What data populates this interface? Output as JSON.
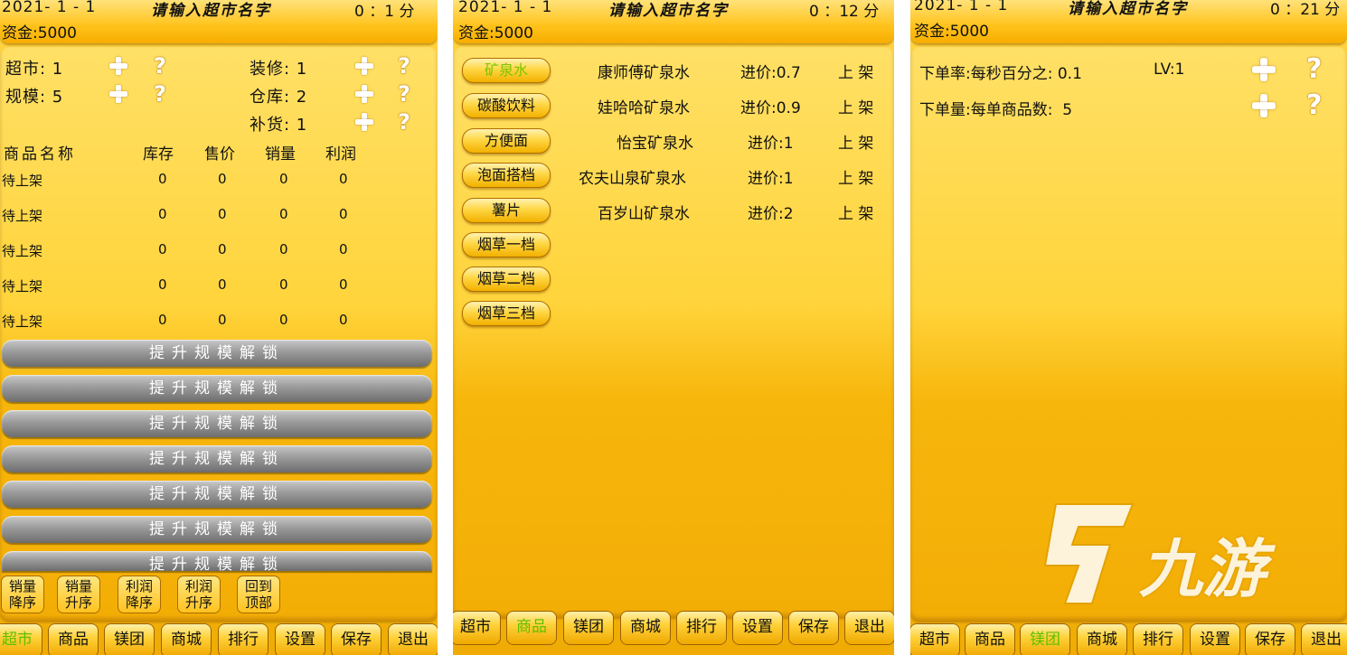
{
  "header": {
    "date": "2021- 1 - 1",
    "store_name": "请输入超市名字",
    "money": "资金:5000"
  },
  "panels": [
    {
      "time": "0 ：1 分"
    },
    {
      "time": "0 ：12 分"
    },
    {
      "time": "0 ：21 分"
    }
  ],
  "p1": {
    "upgrades": {
      "supermarket": "超市: 1",
      "scale": "规模: 5",
      "decoration": "装修: 1",
      "warehouse": "仓库: 2",
      "restock": "补货: 1"
    },
    "table": {
      "headers": [
        "商品名称",
        "库存",
        "售价",
        "销量",
        "利润"
      ],
      "rows": [
        [
          "待上架",
          "0",
          "0",
          "0",
          "0"
        ],
        [
          "待上架",
          "0",
          "0",
          "0",
          "0"
        ],
        [
          "待上架",
          "0",
          "0",
          "0",
          "0"
        ],
        [
          "待上架",
          "0",
          "0",
          "0",
          "0"
        ],
        [
          "待上架",
          "0",
          "0",
          "0",
          "0"
        ]
      ]
    },
    "locked_label": "提升规模解锁",
    "sort_buttons": [
      {
        "l1": "销量",
        "l2": "降序"
      },
      {
        "l1": "销量",
        "l2": "升序"
      },
      {
        "l1": "利润",
        "l2": "降序"
      },
      {
        "l1": "利润",
        "l2": "升序"
      },
      {
        "l1": "回到",
        "l2": "顶部"
      }
    ]
  },
  "p2": {
    "categories": [
      "矿泉水",
      "碳酸饮料",
      "方便面",
      "泡面搭档",
      "薯片",
      "烟草一档",
      "烟草二档",
      "烟草三档"
    ],
    "products": [
      {
        "name": "康师傅矿泉水",
        "price": "进价:0.7",
        "action": "上 架"
      },
      {
        "name": "娃哈哈矿泉水",
        "price": "进价:0.9",
        "action": "上 架"
      },
      {
        "name": "怡宝矿泉水",
        "price": "进价:1",
        "action": "上 架"
      },
      {
        "name": "农夫山泉矿泉水",
        "price": "进价:1",
        "action": "上 架"
      },
      {
        "name": "百岁山矿泉水",
        "price": "进价:2",
        "action": "上 架"
      }
    ]
  },
  "p3": {
    "order_rate": "下单率:每秒百分之: 0.1",
    "level": "LV:1",
    "order_qty": "下单量:每单商品数:  5"
  },
  "nav": [
    "超市",
    "商品",
    "镁团",
    "商城",
    "排行",
    "设置",
    "保存",
    "退出"
  ],
  "watermark": "九游",
  "colors": {
    "accent_active": "#5ec000",
    "panel_yellow": "#ffd23a",
    "locked_grey": "#8a8a8a"
  }
}
